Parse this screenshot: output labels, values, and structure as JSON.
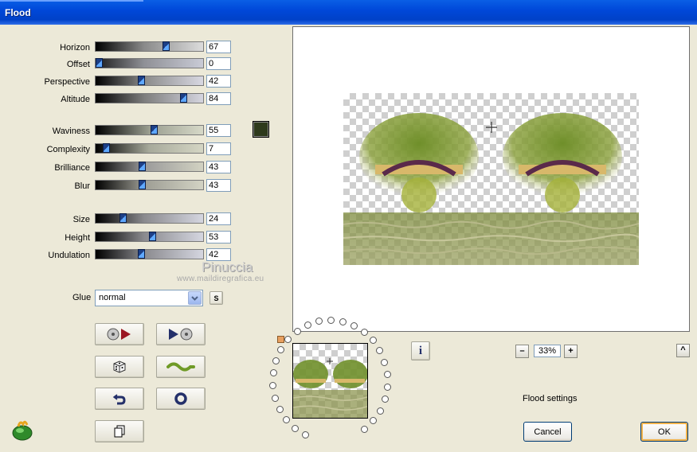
{
  "window": {
    "title": "Flood"
  },
  "sliders": [
    {
      "label": "Horizon",
      "value": "67",
      "level": 0.67
    },
    {
      "label": "Offset",
      "value": "0",
      "level": 0.0
    },
    {
      "label": "Perspective",
      "value": "42",
      "level": 0.42
    },
    {
      "label": "Altitude",
      "value": "84",
      "level": 0.84
    },
    {
      "label": "Waviness",
      "value": "55",
      "level": 0.55
    },
    {
      "label": "Complexity",
      "value": "7",
      "level": 0.07
    },
    {
      "label": "Brilliance",
      "value": "43",
      "level": 0.43
    },
    {
      "label": "Blur",
      "value": "43",
      "level": 0.43
    },
    {
      "label": "Size",
      "value": "24",
      "level": 0.24
    },
    {
      "label": "Height",
      "value": "53",
      "level": 0.53
    },
    {
      "label": "Undulation",
      "value": "42",
      "level": 0.42
    }
  ],
  "color_swatch": "#2e3a1c",
  "watermark": {
    "name": "Pinuccia",
    "url": "www.maildiregrafica.eu"
  },
  "glue": {
    "label": "Glue",
    "selected": "normal",
    "small_button": "S"
  },
  "tool_buttons": [
    {
      "name": "load-preset-button",
      "icon": "disc-arrow-left-icon"
    },
    {
      "name": "save-preset-button",
      "icon": "arrow-disc-right-icon"
    },
    {
      "name": "randomize-button",
      "icon": "dice-icon"
    },
    {
      "name": "wave-button",
      "icon": "wave-icon"
    },
    {
      "name": "undo-button",
      "icon": "undo-arrow-icon"
    },
    {
      "name": "reset-button",
      "icon": "ring-icon"
    },
    {
      "name": "copy-button",
      "icon": "copy-pages-icon"
    }
  ],
  "zoom": {
    "level": "33%",
    "minus": "–",
    "plus": "+"
  },
  "info_label": "i",
  "caret_up": "^",
  "status_text": "Flood settings",
  "buttons": {
    "cancel": "Cancel",
    "ok": "OK"
  }
}
